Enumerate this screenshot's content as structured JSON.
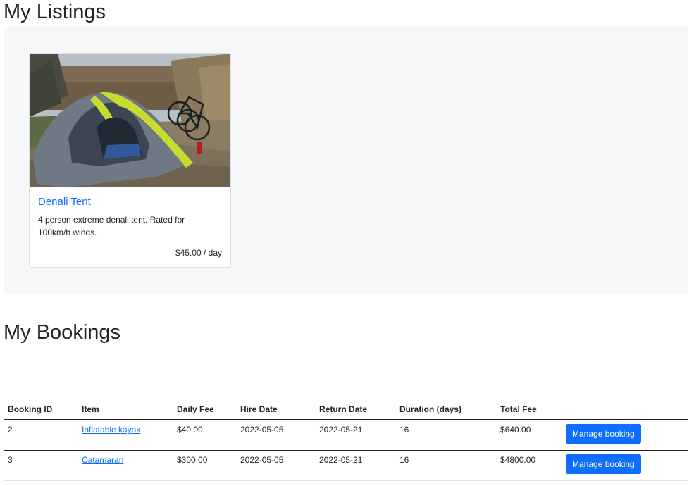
{
  "listings": {
    "heading": "My Listings",
    "cards": [
      {
        "title": "Denali Tent",
        "description": "4 person extreme denali tent. Rated for 100km/h winds.",
        "price": "$45.00 / day",
        "image_icon": "tent-photo"
      }
    ]
  },
  "bookings": {
    "heading": "My Bookings",
    "columns": [
      "Booking ID",
      "Item",
      "Daily Fee",
      "Hire Date",
      "Return Date",
      "Duration (days)",
      "Total Fee",
      ""
    ],
    "rows": [
      {
        "id": "2",
        "item": "Inflatable kayak",
        "daily_fee": "$40.00",
        "hire_date": "2022-05-05",
        "return_date": "2022-05-21",
        "duration": "16",
        "total_fee": "$640.00",
        "action": "Manage booking"
      },
      {
        "id": "3",
        "item": "Catamaran",
        "daily_fee": "$300.00",
        "hire_date": "2022-05-05",
        "return_date": "2022-05-21",
        "duration": "16",
        "total_fee": "$4800.00",
        "action": "Manage booking"
      }
    ]
  },
  "colors": {
    "link": "#0d6efd",
    "button": "#0d6efd",
    "panel": "#f6f7f9"
  }
}
